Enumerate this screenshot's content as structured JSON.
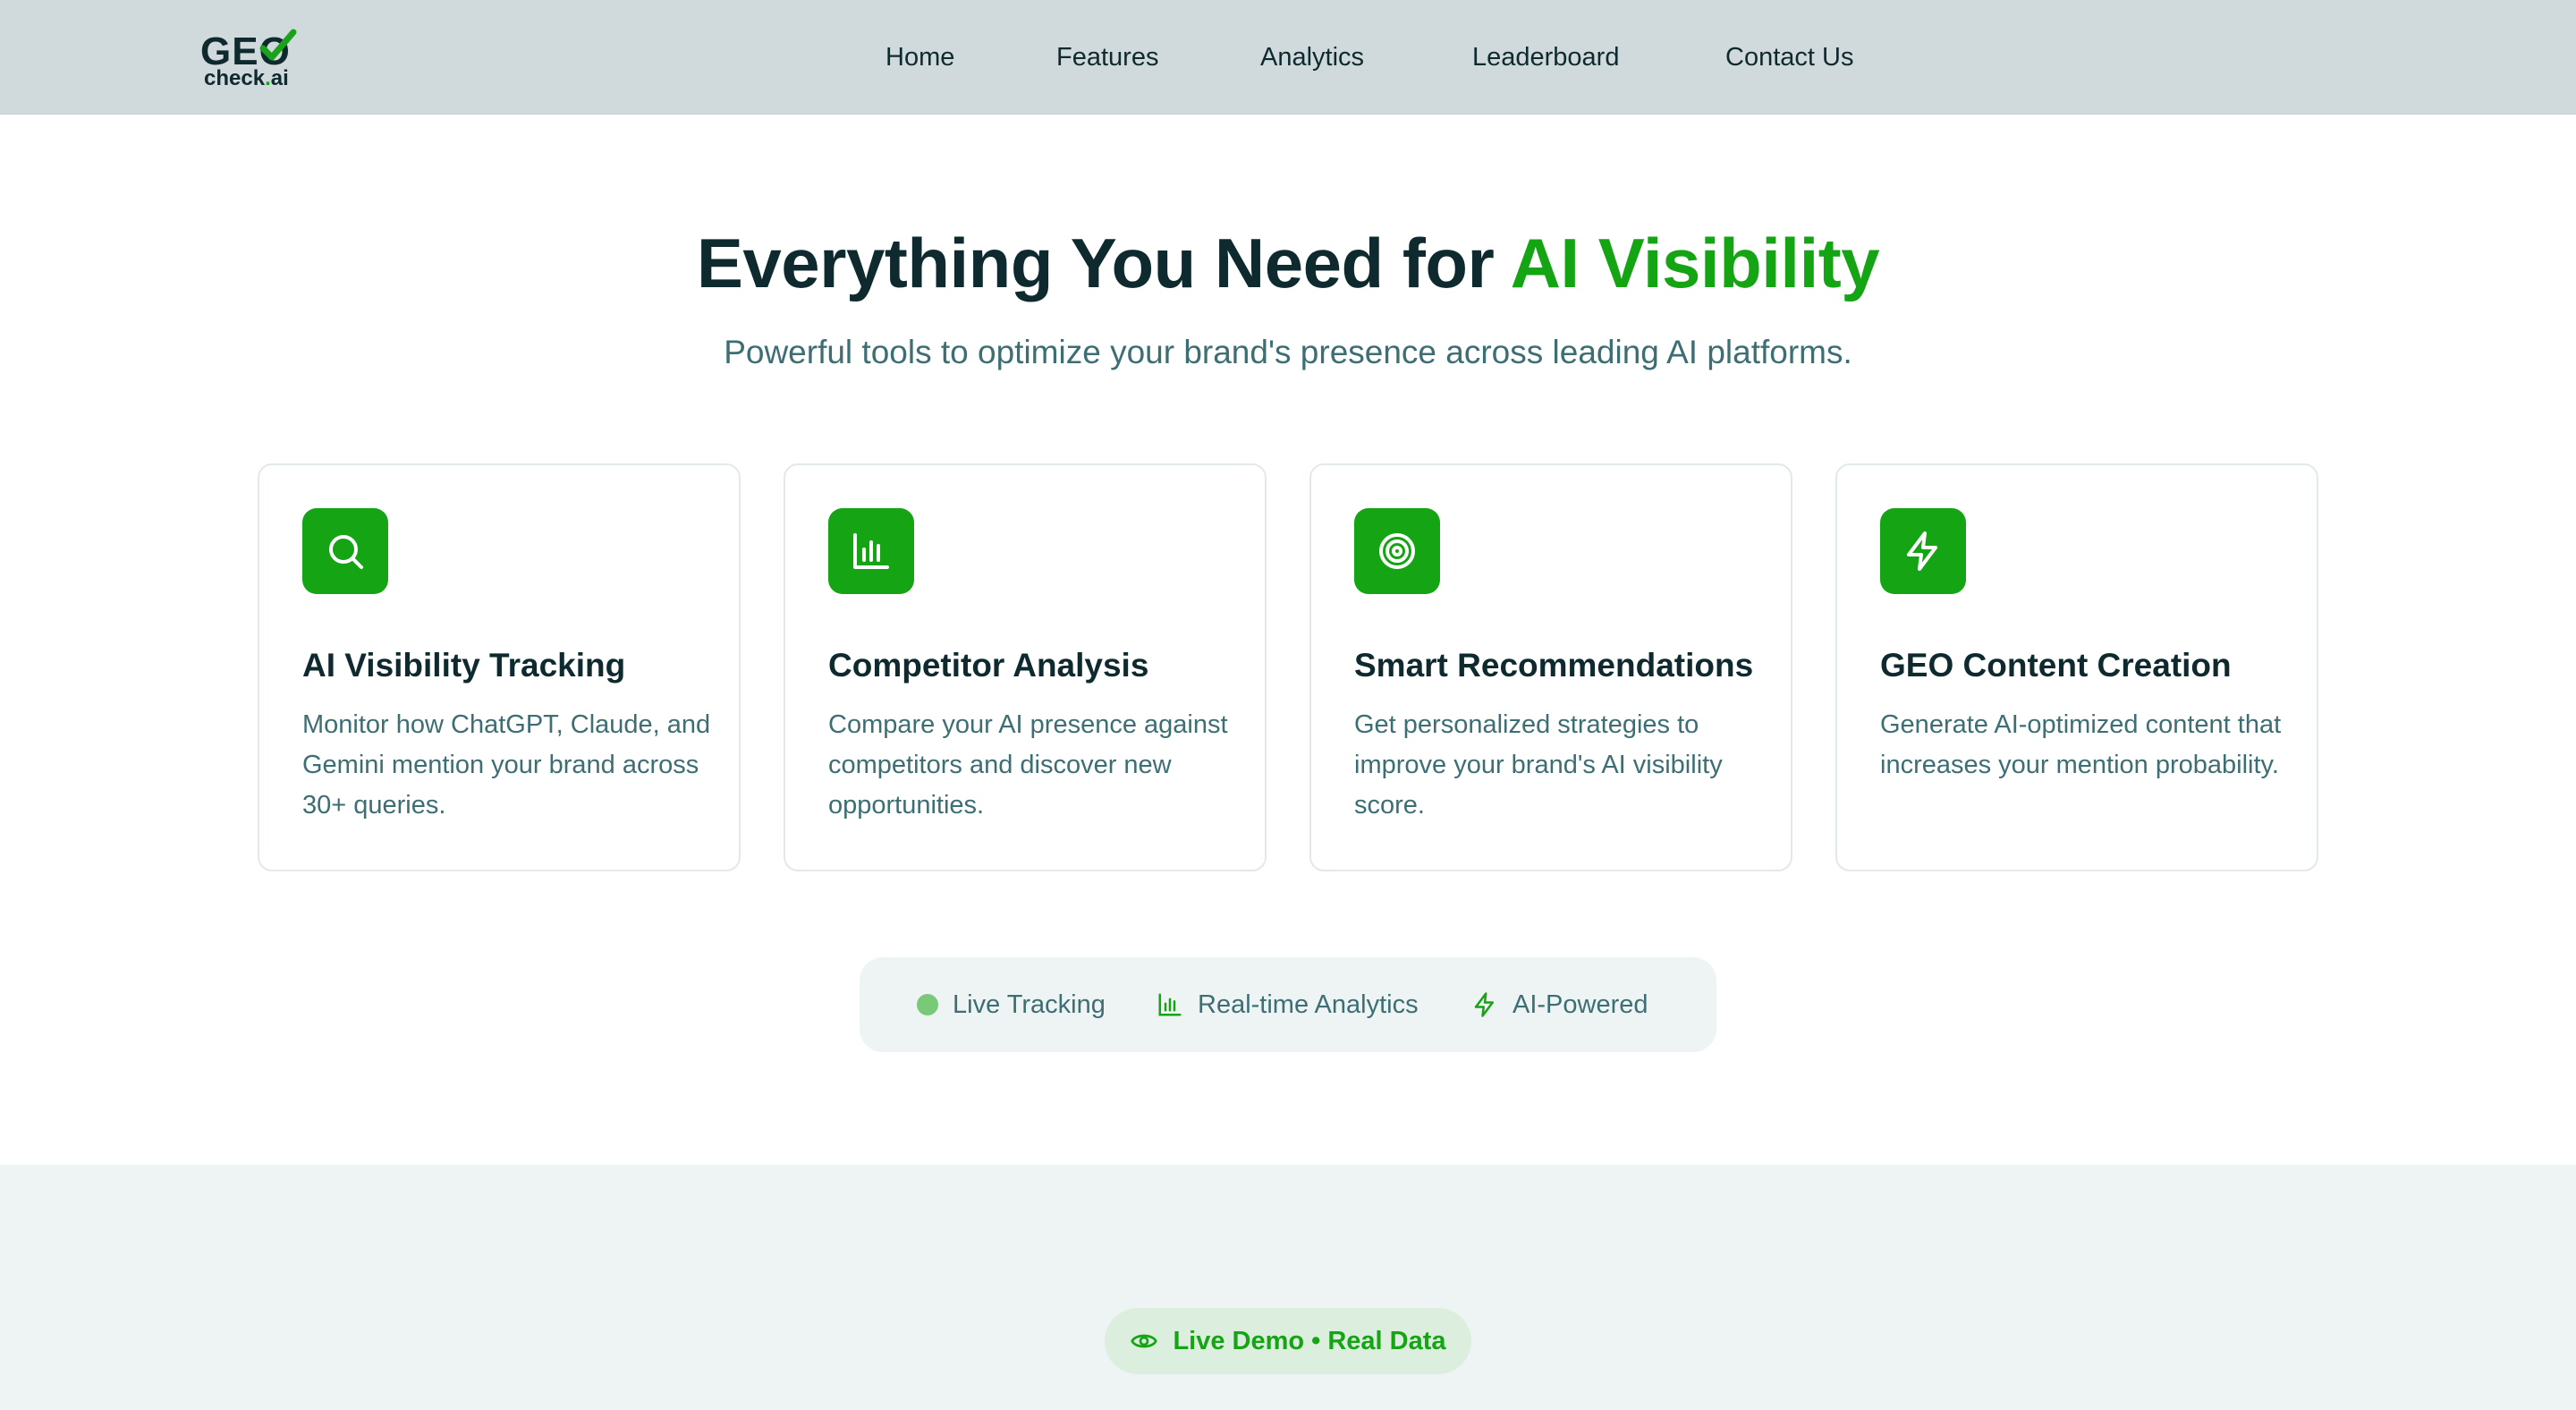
{
  "header": {
    "logo": {
      "main": "GEO",
      "sub_prefix": "check",
      "sub_dot": ".",
      "sub_suffix": "ai"
    },
    "nav": [
      {
        "label": "Home"
      },
      {
        "label": "Features"
      },
      {
        "label": "Analytics"
      },
      {
        "label": "Leaderboard"
      },
      {
        "label": "Contact Us"
      }
    ]
  },
  "hero": {
    "title_prefix": "Everything You Need for ",
    "title_accent": "AI Visibility",
    "subtitle": "Powerful tools to optimize your brand's presence across leading AI platforms."
  },
  "features": [
    {
      "icon": "search-icon",
      "title": "AI Visibility Tracking",
      "description": "Monitor how ChatGPT, Claude, and Gemini mention your brand across 30+ queries."
    },
    {
      "icon": "bar-chart-icon",
      "title": "Competitor Analysis",
      "description": "Compare your AI presence against competitors and discover new opportunities."
    },
    {
      "icon": "target-icon",
      "title": "Smart Recommendations",
      "description": "Get personalized strategies to improve your brand's AI visibility score."
    },
    {
      "icon": "lightning-icon",
      "title": "GEO Content Creation",
      "description": "Generate AI-optimized content that increases your mention probability."
    }
  ],
  "highlights": [
    {
      "icon": "live-dot-icon",
      "label": "Live Tracking"
    },
    {
      "icon": "bar-chart-icon",
      "label": "Real-time Analytics"
    },
    {
      "icon": "lightning-icon",
      "label": "AI-Powered"
    }
  ],
  "demo_badge": {
    "icon": "eye-icon",
    "label": "Live Demo • Real Data"
  },
  "colors": {
    "accent": "#14a414",
    "heading": "#0f2a2e",
    "body_text": "#3d6e74",
    "header_bg": "#d0d9dc",
    "band_bg": "#eef4f4"
  }
}
